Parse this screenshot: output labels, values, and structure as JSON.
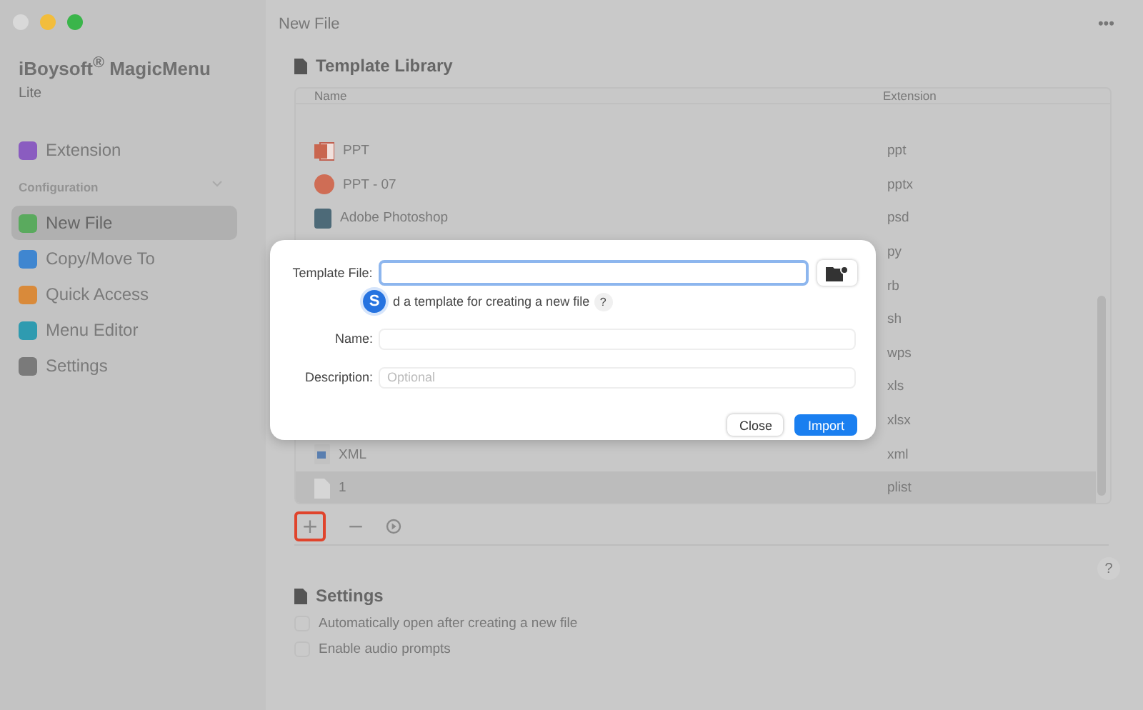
{
  "window": {
    "title": "New File",
    "more": "•••"
  },
  "sidebar": {
    "app_name": "iBoysoft$^{®}$ MagicMenu",
    "edition": "Lite",
    "top_items": [
      {
        "label": "Extension",
        "color": "#8a5cc0",
        "selected": false
      }
    ],
    "section": "Configuration",
    "items": [
      {
        "label": "New File",
        "color": "#5aaa5e",
        "selected": true
      },
      {
        "label": "Copy/Move To",
        "color": "#3f86d0",
        "selected": false
      },
      {
        "label": "Quick Access",
        "color": "#d98a3a",
        "selected": false
      },
      {
        "label": "Menu Editor",
        "color": "#2f9bb0",
        "selected": false
      },
      {
        "label": "Settings",
        "color": "#7a7a7a",
        "selected": false
      }
    ]
  },
  "template_library": {
    "heading": "Template Library",
    "columns": [
      "Name",
      "Extension"
    ],
    "rows": [
      {
        "name": "PPT",
        "extension": "ppt",
        "kind": "ppt",
        "selected": false
      },
      {
        "name": "PPT - 07",
        "extension": "pptx",
        "kind": "pptx",
        "selected": false
      },
      {
        "name": "Adobe Photoshop",
        "extension": "psd",
        "kind": "psd",
        "selected": false
      },
      {
        "extension": "py",
        "selected": false
      },
      {
        "extension": "rb",
        "selected": false
      },
      {
        "extension": "sh",
        "selected": false
      },
      {
        "extension": "wps",
        "selected": false
      },
      {
        "extension": "xls",
        "selected": false
      },
      {
        "extension": "xlsx",
        "selected": false
      },
      {
        "name": "XML",
        "extension": "xml",
        "kind": "xml",
        "selected": false
      },
      {
        "name": "1",
        "extension": "plist",
        "kind": "generic",
        "selected": true
      }
    ],
    "toolbar": [
      "+",
      "−"
    ]
  },
  "help": "?",
  "settings": {
    "heading": "Settings",
    "options": [
      {
        "label": "Automatically open after creating a new file",
        "checked": false
      },
      {
        "label": "Enable audio prompts",
        "checked": false
      }
    ]
  },
  "dialog": {
    "fields": [
      {
        "label": "Template File:",
        "focused": true
      },
      {
        "label": "Name:",
        "focused": false
      },
      {
        "label": "Description:",
        "placeholder": "Optional",
        "focused": false
      }
    ],
    "hint": "d a template for creating a new file",
    "hint_help": "?",
    "badge": "S",
    "buttons": [
      {
        "label": "Close",
        "primary": false
      },
      {
        "label": "Import",
        "primary": true
      }
    ]
  }
}
